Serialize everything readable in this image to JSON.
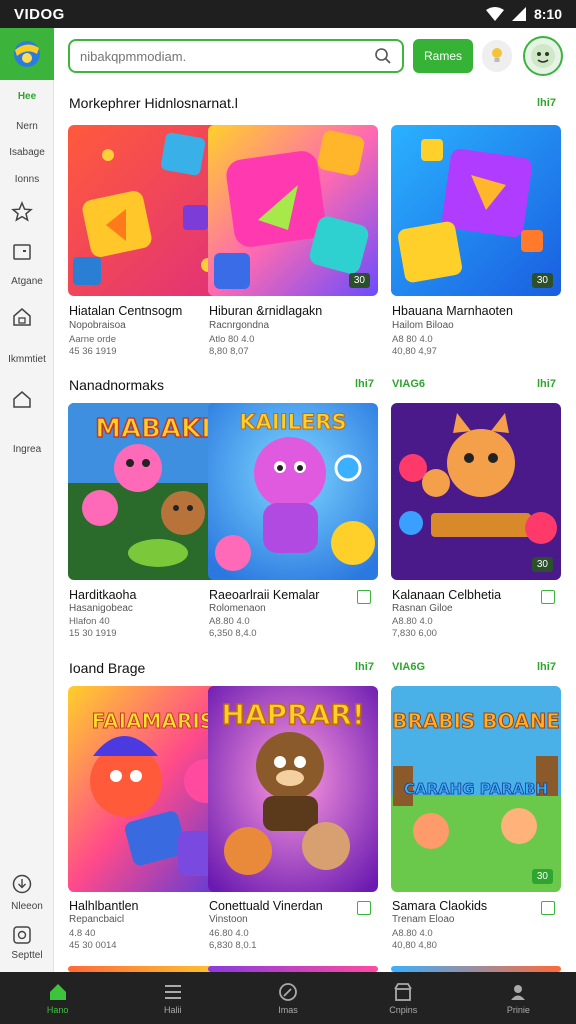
{
  "status_bar": {
    "title": "VIDOG",
    "time": "8:10"
  },
  "sidebar": {
    "items": [
      {
        "label": "Hee"
      },
      {
        "label": "Nern"
      },
      {
        "label": "Isabage"
      },
      {
        "label": "Ionns"
      },
      {
        "label": "Atgane"
      },
      {
        "label": "Ikmmtiet"
      },
      {
        "label": "Ingrea"
      },
      {
        "label": "Nleeon"
      },
      {
        "label": "Septtel"
      }
    ]
  },
  "header": {
    "search_placeholder": "nibakqpmmodiam.",
    "games_button": "Rames"
  },
  "sections": [
    {
      "title": "Morkephrer Hidnlosnarnat.l",
      "link": "lhi7",
      "cards": [
        {
          "title": "Hiatalan Centnsogm",
          "subtitle": "Nopobraisoa",
          "meta1": "Aarne orde",
          "meta2": "45 36  1919",
          "badge": ""
        },
        {
          "title": "Hiburan &rnidlagakn",
          "subtitle": "Racnrgondna",
          "meta1": "Atlo  80  4.0",
          "meta2": "8,80  8,07",
          "badge": "30"
        },
        {
          "title": "Hbauana Marnhaoten",
          "subtitle": "Hailom Biloao",
          "meta1": "A8 80  4.0",
          "meta2": "40,80  4,97",
          "badge": "30"
        }
      ]
    },
    {
      "title": "Nanadnormaks",
      "link": "lhi7",
      "link_mid": "VIAG6",
      "cards": [
        {
          "title": "Harditkaoha",
          "subtitle": "Hasanigobeac",
          "meta1": "Hlafon  40",
          "meta2": "15 30  1919",
          "badge": ""
        },
        {
          "title": "Raeoarlraii Kemalar",
          "subtitle": "Rolomenaon",
          "meta1": "A8.80  4.0",
          "meta2": "6,350  8,4.0",
          "badge": ""
        },
        {
          "title": "Kalanaan Celbhetia",
          "subtitle": "Rasnan Giloe",
          "meta1": "A8.80  4.0",
          "meta2": "7,830  6,00",
          "badge": "30"
        }
      ]
    },
    {
      "title": "Ioand Brage",
      "link": "lhi7",
      "link_mid": "VIA6G",
      "cards": [
        {
          "title": "Halhlbantlen",
          "subtitle": "Repancbaicl",
          "meta1": "4.8  40",
          "meta2": "45 30  0014",
          "badge": ""
        },
        {
          "title": "Conettuald Vinerdan",
          "subtitle": "Vinstoon",
          "meta1": "46.80  4.0",
          "meta2": "6,830  8,0.1",
          "badge": ""
        },
        {
          "title": "Samara Claokids",
          "subtitle": "Trenam Eloao",
          "meta1": "A8.80  4.0",
          "meta2": "40,80  4,80",
          "badge": "30"
        }
      ]
    }
  ],
  "art_text": [
    "MABAKI",
    "KAIILERS",
    "FAIAMARIS",
    "HAPRAR!",
    "BRABIS BOANE",
    "CARAHG PARABH"
  ],
  "bottom_nav": [
    {
      "label": "Hano"
    },
    {
      "label": "Halii"
    },
    {
      "label": "Imas"
    },
    {
      "label": "Cnpins"
    },
    {
      "label": "Prinie"
    }
  ]
}
